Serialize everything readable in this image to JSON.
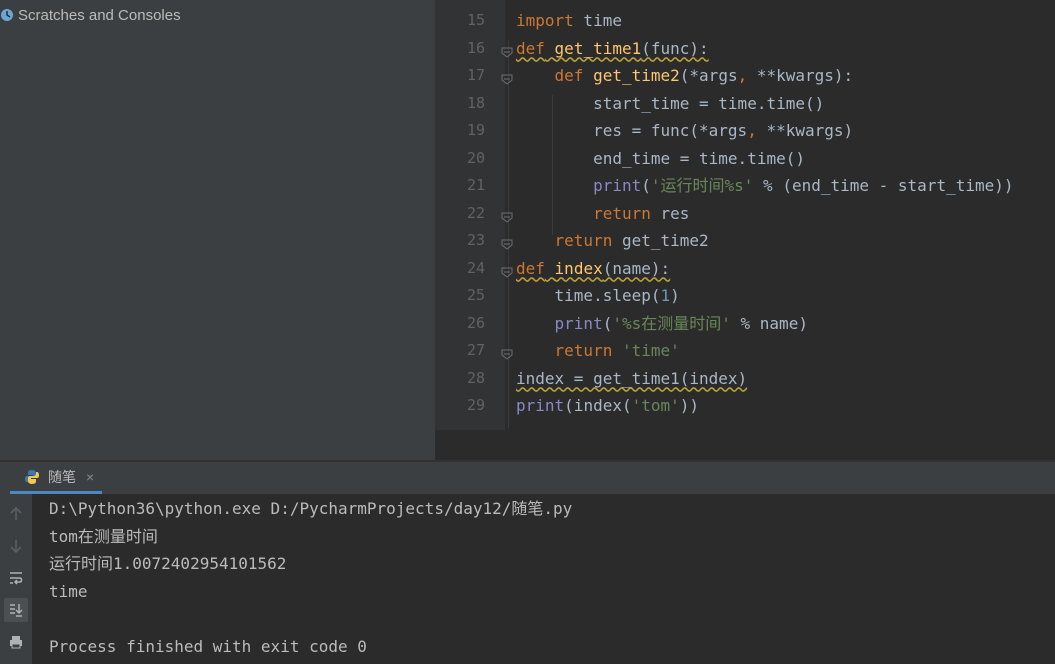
{
  "project": {
    "item_label": "Scratches and Consoles"
  },
  "editor": {
    "line_numbers": [
      "15",
      "16",
      "17",
      "18",
      "19",
      "20",
      "21",
      "22",
      "23",
      "24",
      "25",
      "26",
      "27",
      "28",
      "29"
    ],
    "lines": [
      [
        {
          "t": "import",
          "c": "kw"
        },
        {
          "t": " time",
          "c": ""
        }
      ],
      [
        {
          "t": "def",
          "c": "kw warn"
        },
        {
          "t": " ",
          "c": "warn"
        },
        {
          "t": "get_time1",
          "c": "fn warn"
        },
        {
          "t": "(func):",
          "c": "warn"
        }
      ],
      [
        {
          "t": "    ",
          "c": ""
        },
        {
          "t": "def",
          "c": "kw"
        },
        {
          "t": " ",
          "c": ""
        },
        {
          "t": "get_time2",
          "c": "fn"
        },
        {
          "t": "(*args",
          "c": ""
        },
        {
          "t": ",",
          "c": "kw"
        },
        {
          "t": " **kwargs):",
          "c": ""
        }
      ],
      [
        {
          "t": "        start_time = time.time()",
          "c": ""
        }
      ],
      [
        {
          "t": "        res = func(*args",
          "c": ""
        },
        {
          "t": ",",
          "c": "kw"
        },
        {
          "t": " **kwargs)",
          "c": ""
        }
      ],
      [
        {
          "t": "        end_time = time.time()",
          "c": ""
        }
      ],
      [
        {
          "t": "        ",
          "c": ""
        },
        {
          "t": "print",
          "c": "bi"
        },
        {
          "t": "(",
          "c": ""
        },
        {
          "t": "'运行时间%s'",
          "c": "str"
        },
        {
          "t": " % (end_time - start_time))",
          "c": ""
        }
      ],
      [
        {
          "t": "        ",
          "c": ""
        },
        {
          "t": "return",
          "c": "kw"
        },
        {
          "t": " res",
          "c": ""
        }
      ],
      [
        {
          "t": "    ",
          "c": ""
        },
        {
          "t": "return",
          "c": "kw"
        },
        {
          "t": " get_time2",
          "c": ""
        }
      ],
      [
        {
          "t": "def",
          "c": "kw warn"
        },
        {
          "t": " ",
          "c": "warn"
        },
        {
          "t": "index",
          "c": "fn warn"
        },
        {
          "t": "(name):",
          "c": "warn"
        }
      ],
      [
        {
          "t": "    time.sleep(",
          "c": ""
        },
        {
          "t": "1",
          "c": "num"
        },
        {
          "t": ")",
          "c": ""
        }
      ],
      [
        {
          "t": "    ",
          "c": ""
        },
        {
          "t": "print",
          "c": "bi"
        },
        {
          "t": "(",
          "c": ""
        },
        {
          "t": "'%s在测量时间'",
          "c": "str"
        },
        {
          "t": " % name)",
          "c": ""
        }
      ],
      [
        {
          "t": "    ",
          "c": ""
        },
        {
          "t": "return",
          "c": "kw"
        },
        {
          "t": " ",
          "c": ""
        },
        {
          "t": "'time'",
          "c": "str"
        }
      ],
      [
        {
          "t": "index = get_time1(index)",
          "c": "warn"
        }
      ],
      [
        {
          "t": "print",
          "c": "bi"
        },
        {
          "t": "(index(",
          "c": ""
        },
        {
          "t": "'tom'",
          "c": "str"
        },
        {
          "t": "))",
          "c": ""
        }
      ]
    ]
  },
  "run": {
    "tab_label": "随笔",
    "tab_close": "×",
    "output": [
      "D:\\Python36\\python.exe D:/PycharmProjects/day12/随笔.py",
      "tom在测量时间",
      "运行时间1.0072402954101562",
      "time",
      "",
      "Process finished with exit code 0"
    ]
  },
  "colors": {
    "accent": "#4a88c7",
    "keyword": "#cc7832",
    "function": "#ffc66d",
    "string": "#6a8759",
    "builtin": "#8888c6"
  }
}
